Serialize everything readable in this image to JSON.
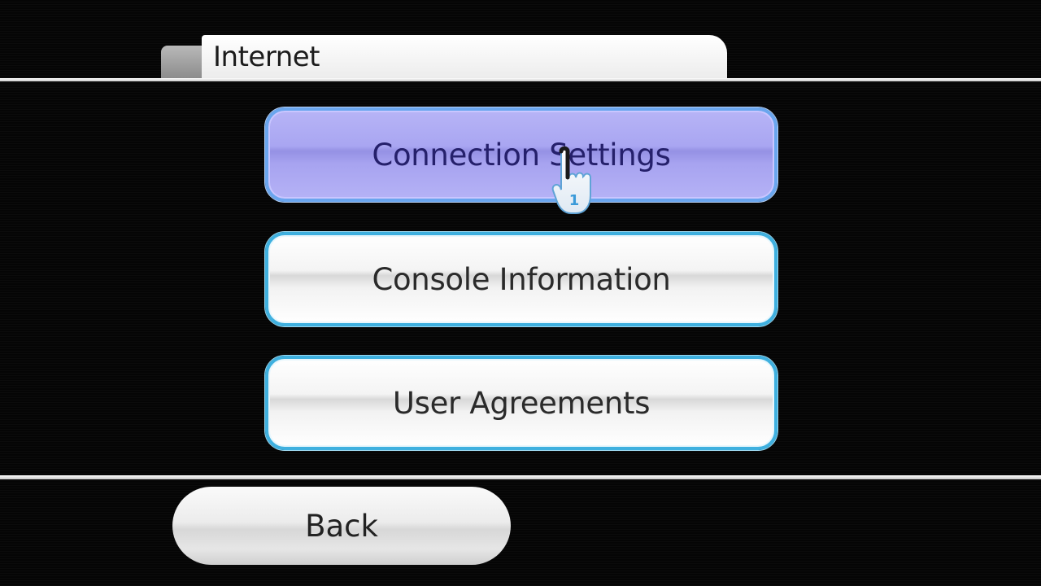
{
  "header": {
    "title": "Internet"
  },
  "menu": {
    "items": [
      {
        "label": "Connection Settings",
        "selected": true
      },
      {
        "label": "Console Information",
        "selected": false
      },
      {
        "label": "User Agreements",
        "selected": false
      }
    ]
  },
  "footer": {
    "back_label": "Back"
  },
  "pointer": {
    "icon": "hand-pointer-icon",
    "player_number": "1"
  },
  "colors": {
    "selected_fill": "#a9a6f2",
    "button_border": "#3fb0df",
    "background": "#050505"
  }
}
